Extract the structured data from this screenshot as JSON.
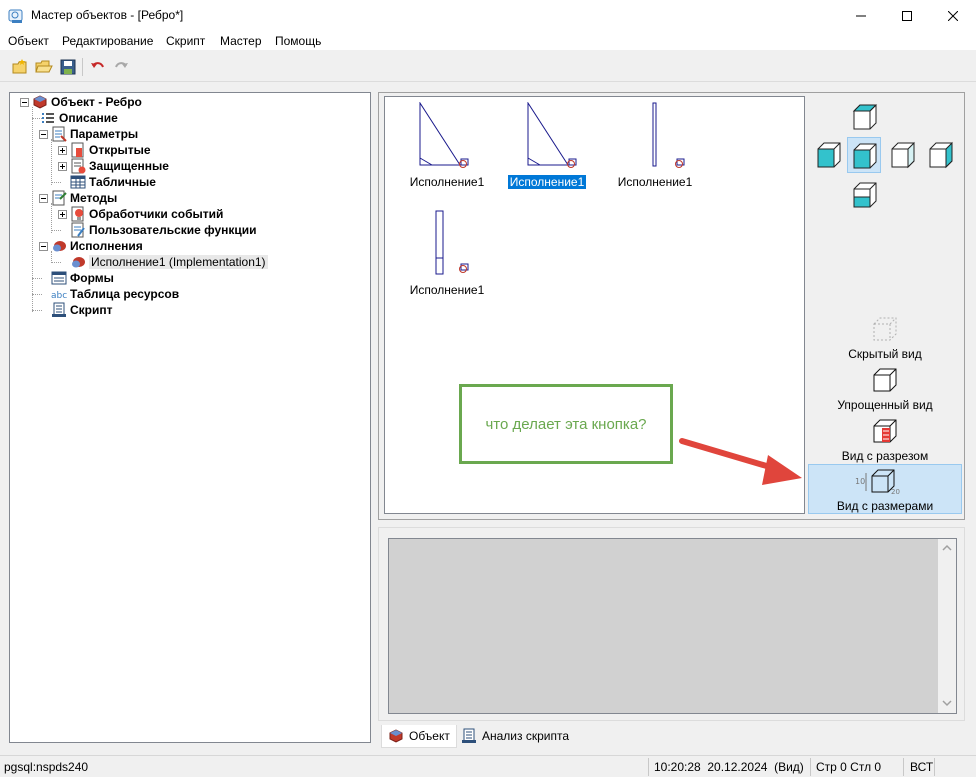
{
  "window": {
    "title": "Мастер объектов - [Ребро*]",
    "controls": [
      "minimize",
      "maximize",
      "close"
    ]
  },
  "menu": {
    "items": [
      "Объект",
      "Редактирование",
      "Скрипт",
      "Мастер",
      "Помощь"
    ]
  },
  "toolbar": {
    "buttons": [
      "new-object-icon",
      "open-folder-icon",
      "save-icon",
      "undo-icon",
      "redo-icon"
    ]
  },
  "tree": {
    "root": "Объект - Ребро",
    "items": [
      {
        "label": "Описание",
        "level": 1,
        "icon": "list-icon"
      },
      {
        "label": "Параметры",
        "level": 1,
        "icon": "params-icon",
        "expanded": true
      },
      {
        "label": "Открытые",
        "level": 2,
        "icon": "open-params-icon",
        "expander": "plus"
      },
      {
        "label": "Защищенные",
        "level": 2,
        "icon": "protected-params-icon",
        "expander": "plus"
      },
      {
        "label": "Табличные",
        "level": 2,
        "icon": "table-icon"
      },
      {
        "label": "Методы",
        "level": 1,
        "icon": "methods-icon",
        "expanded": true
      },
      {
        "label": "Обработчики событий",
        "level": 2,
        "icon": "event-handlers-icon",
        "expander": "plus"
      },
      {
        "label": "Пользовательские функции",
        "level": 2,
        "icon": "user-functions-icon"
      },
      {
        "label": "Исполнения",
        "level": 1,
        "icon": "implementations-icon",
        "expanded": true
      },
      {
        "label": "Исполнение1 (Implementation1)",
        "level": 2,
        "icon": "implementation-icon",
        "selected": true
      },
      {
        "label": "Формы",
        "level": 1,
        "icon": "forms-icon"
      },
      {
        "label": "Таблица ресурсов",
        "level": 1,
        "icon": "abc-icon"
      },
      {
        "label": "Скрипт",
        "level": 1,
        "icon": "script-icon"
      }
    ]
  },
  "preview": {
    "implementations": [
      {
        "label": "Исполнение1",
        "selected": false,
        "shape": "triangle"
      },
      {
        "label": "Исполнение1",
        "selected": true,
        "shape": "triangle"
      },
      {
        "label": "Исполнение1",
        "selected": false,
        "shape": "thin-bar"
      },
      {
        "label": "Исполнение1",
        "selected": false,
        "shape": "bar-split"
      }
    ]
  },
  "view_orientation": {
    "buttons": [
      "view-top-icon",
      "view-left-icon",
      "view-front-icon",
      "view-right-icon",
      "view-back-icon",
      "view-bottom-icon"
    ],
    "active": "view-front-icon"
  },
  "display_modes": [
    {
      "label": "Скрытый вид",
      "icon": "hidden-view-icon",
      "active": false
    },
    {
      "label": "Упрощенный вид",
      "icon": "simplified-view-icon",
      "active": false
    },
    {
      "label": "Вид с разрезом",
      "icon": "section-view-icon",
      "active": false
    },
    {
      "label": "Вид с размерами",
      "icon": "dimension-view-icon",
      "active": true
    }
  ],
  "annotation": {
    "text": "что делает эта кнопка?",
    "border_color": "#6aa84f",
    "arrow_color": "#e0453c"
  },
  "bottom_tabs": [
    {
      "label": "Объект",
      "active": true,
      "icon": "object-tab-icon"
    },
    {
      "label": "Анализ скрипта",
      "active": false,
      "icon": "script-analysis-icon"
    }
  ],
  "statusbar": {
    "connection": "pgsql:nspds240",
    "datetime": "10:20:28  20.12.2024  (Вид)",
    "position": "Стр 0 Стл 0",
    "mode": "ВСТ"
  },
  "colors": {
    "accent": "#0078d7",
    "selection_bg": "#cce4f7",
    "selection_border": "#99c9ef"
  }
}
